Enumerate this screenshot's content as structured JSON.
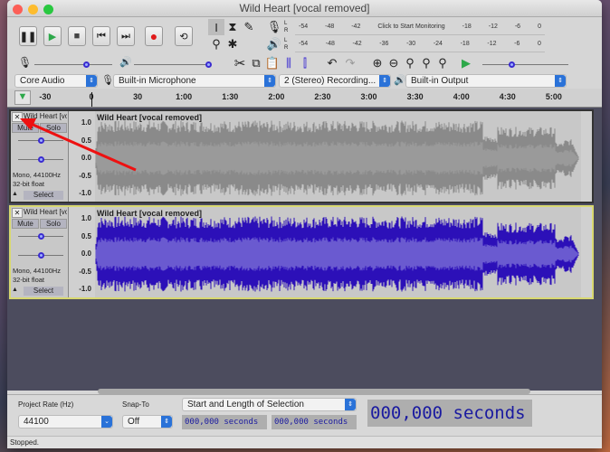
{
  "window": {
    "title": "Wild Heart [vocal removed]"
  },
  "transport": {
    "buttons": [
      "pause",
      "play",
      "stop",
      "skip-to-start",
      "skip-to-end",
      "record",
      "loop"
    ]
  },
  "meters": {
    "record_ticks": [
      "-54",
      "-48",
      "-42",
      "Click to Start Monitoring",
      "-18",
      "-12",
      "-6",
      "0"
    ],
    "play_ticks": [
      "-54",
      "-48",
      "-42",
      "-36",
      "-30",
      "-24",
      "-18",
      "-12",
      "-6",
      "0"
    ],
    "record_lr": [
      "L",
      "R"
    ],
    "play_lr": [
      "L",
      "R"
    ]
  },
  "devices": {
    "host": "Core Audio",
    "input": "Built-in Microphone",
    "channels": "2 (Stereo) Recording...",
    "output": "Built-in Output"
  },
  "ruler": {
    "ticks": [
      "-30",
      "0",
      "30",
      "1:00",
      "1:30",
      "2:00",
      "2:30",
      "3:00",
      "3:30",
      "4:00",
      "4:30",
      "5:00"
    ]
  },
  "tracks": [
    {
      "name": "Wild Heart [voc",
      "clip": "Wild Heart [vocal removed]",
      "mute": "Mute",
      "solo": "Solo",
      "info1": "Mono, 44100Hz",
      "info2": "32-bit float",
      "select": "Select",
      "scale": [
        "1.0",
        "0.5",
        "0.0",
        "-0.5",
        "-1.0"
      ],
      "color": "#8a8a8a",
      "rms": "#9a9a9a",
      "bg": "#c8c8c8"
    },
    {
      "name": "Wild Heart [voc",
      "clip": "Wild Heart [vocal removed]",
      "mute": "Mute",
      "solo": "Solo",
      "info1": "Mono, 44100Hz",
      "info2": "32-bit float",
      "select": "Select",
      "scale": [
        "1.0",
        "0.5",
        "0.0",
        "-0.5",
        "-1.0"
      ],
      "color": "#2c10b8",
      "rms": "#6a5ad0",
      "bg": "#c8c8c8"
    }
  ],
  "bottom": {
    "rate_label": "Project Rate (Hz)",
    "rate_value": "44100",
    "snap_label": "Snap-To",
    "snap_value": "Off",
    "selection_mode": "Start and Length of Selection",
    "sel_start": "000,000 seconds",
    "sel_length": "000,000 seconds",
    "audio_position": "000,000 seconds"
  },
  "status": "Stopped.",
  "colors": {
    "accent": "#2a72d8",
    "knob": "#3a2bd0",
    "arrow": "#ee1111"
  }
}
